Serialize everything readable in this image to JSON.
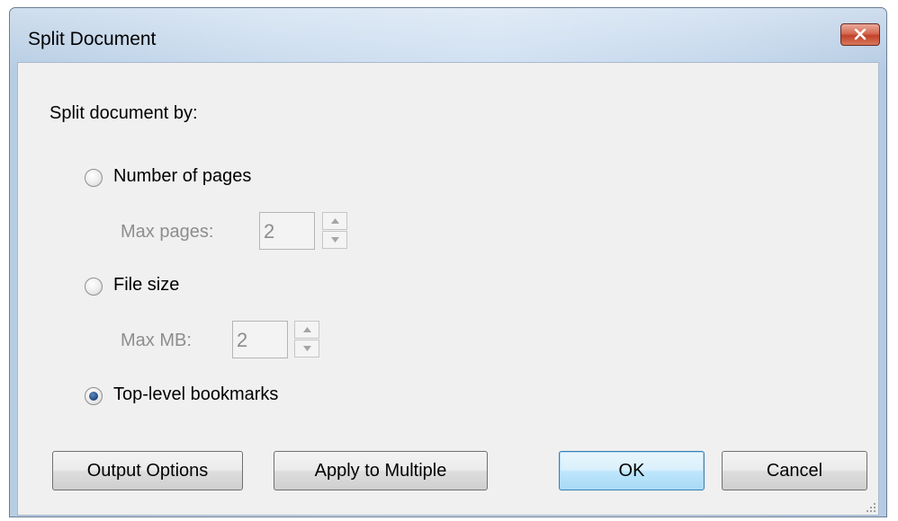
{
  "dialog": {
    "title": "Split Document",
    "heading": "Split document by:",
    "options": {
      "pages_label": "Number of pages",
      "max_pages_label": "Max pages:",
      "max_pages_value": "2",
      "filesize_label": "File size",
      "max_mb_label": "Max MB:",
      "max_mb_value": "2",
      "bookmarks_label": "Top-level bookmarks",
      "selected": "Top-level bookmarks"
    },
    "buttons": {
      "output_options": "Output Options",
      "apply_multiple": "Apply to Multiple",
      "ok": "OK",
      "cancel": "Cancel"
    },
    "icons": {
      "close": "close-icon",
      "spin_up": "arrow-up-icon",
      "spin_down": "arrow-down-icon",
      "resize": "resize-grip-icon"
    },
    "colors": {
      "close_button": "#c1432a",
      "default_button_border": "#3c7fb1",
      "disabled_text": "#8d8d8d"
    }
  }
}
